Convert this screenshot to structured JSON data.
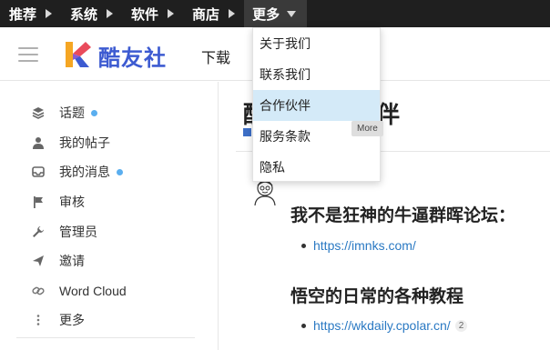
{
  "topnav": {
    "items": [
      {
        "label": "推荐"
      },
      {
        "label": "系统"
      },
      {
        "label": "软件"
      },
      {
        "label": "商店"
      },
      {
        "label": "更多"
      }
    ]
  },
  "header": {
    "site_name": "酷友社",
    "download_label": "下载"
  },
  "sidebar": {
    "items": [
      {
        "label": "话题",
        "icon": "layers-icon",
        "unread": true
      },
      {
        "label": "我的帖子",
        "icon": "user-icon",
        "unread": false
      },
      {
        "label": "我的消息",
        "icon": "inbox-icon",
        "unread": true
      },
      {
        "label": "审核",
        "icon": "flag-icon",
        "unread": false
      },
      {
        "label": "管理员",
        "icon": "wrench-icon",
        "unread": false
      },
      {
        "label": "邀请",
        "icon": "send-icon",
        "unread": false
      },
      {
        "label": "Word Cloud",
        "icon": "link-icon",
        "unread": false
      },
      {
        "label": "更多",
        "icon": "more-vertical-icon",
        "unread": false
      }
    ]
  },
  "main": {
    "title_visible_start": "酷",
    "title_visible_end": "伴",
    "heading_1": "我不是狂神的牛逼群晖论坛：",
    "link_1": "https://imnks.com/",
    "heading_2": "悟空的日常的各种教程",
    "link_2": "https://wkdaily.cpolar.cn/",
    "link_2_count": "2"
  },
  "dropdown": {
    "items": [
      {
        "label": "关于我们"
      },
      {
        "label": "联系我们"
      },
      {
        "label": "合作伙伴"
      },
      {
        "label": "服务条款"
      },
      {
        "label": "隐私"
      }
    ],
    "highlighted_index": 2
  },
  "tooltip": {
    "text": "More"
  },
  "colors": {
    "topnav_bg": "#1f1f1f",
    "brand": "#3d5bd1",
    "link": "#2a79c3",
    "highlight": "#d4eaf8",
    "unread_dot": "#5aaeef"
  }
}
